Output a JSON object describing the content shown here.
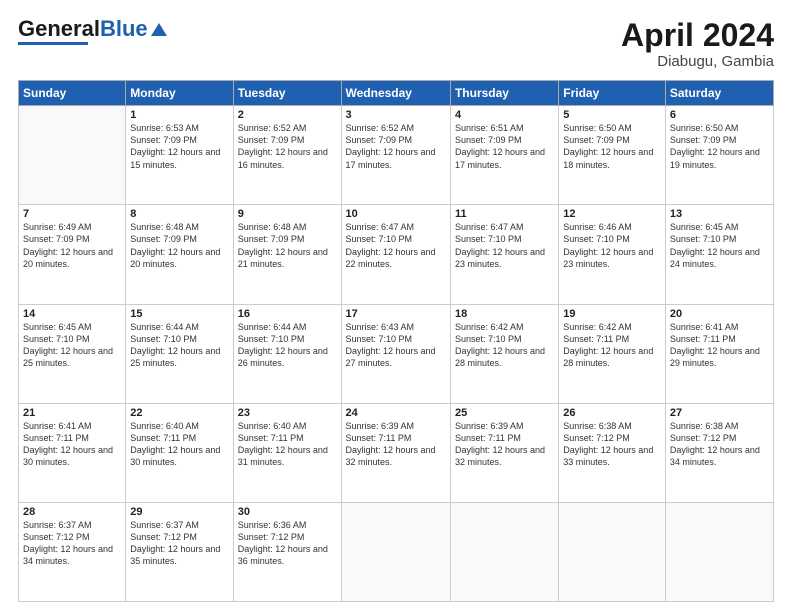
{
  "header": {
    "logo_general": "General",
    "logo_blue": "Blue",
    "month_year": "April 2024",
    "location": "Diabugu, Gambia"
  },
  "weekdays": [
    "Sunday",
    "Monday",
    "Tuesday",
    "Wednesday",
    "Thursday",
    "Friday",
    "Saturday"
  ],
  "weeks": [
    [
      {
        "day": null
      },
      {
        "day": 1,
        "sunrise": "6:53 AM",
        "sunset": "7:09 PM",
        "daylight": "12 hours and 15 minutes."
      },
      {
        "day": 2,
        "sunrise": "6:52 AM",
        "sunset": "7:09 PM",
        "daylight": "12 hours and 16 minutes."
      },
      {
        "day": 3,
        "sunrise": "6:52 AM",
        "sunset": "7:09 PM",
        "daylight": "12 hours and 17 minutes."
      },
      {
        "day": 4,
        "sunrise": "6:51 AM",
        "sunset": "7:09 PM",
        "daylight": "12 hours and 17 minutes."
      },
      {
        "day": 5,
        "sunrise": "6:50 AM",
        "sunset": "7:09 PM",
        "daylight": "12 hours and 18 minutes."
      },
      {
        "day": 6,
        "sunrise": "6:50 AM",
        "sunset": "7:09 PM",
        "daylight": "12 hours and 19 minutes."
      }
    ],
    [
      {
        "day": 7,
        "sunrise": "6:49 AM",
        "sunset": "7:09 PM",
        "daylight": "12 hours and 20 minutes."
      },
      {
        "day": 8,
        "sunrise": "6:48 AM",
        "sunset": "7:09 PM",
        "daylight": "12 hours and 20 minutes."
      },
      {
        "day": 9,
        "sunrise": "6:48 AM",
        "sunset": "7:09 PM",
        "daylight": "12 hours and 21 minutes."
      },
      {
        "day": 10,
        "sunrise": "6:47 AM",
        "sunset": "7:10 PM",
        "daylight": "12 hours and 22 minutes."
      },
      {
        "day": 11,
        "sunrise": "6:47 AM",
        "sunset": "7:10 PM",
        "daylight": "12 hours and 23 minutes."
      },
      {
        "day": 12,
        "sunrise": "6:46 AM",
        "sunset": "7:10 PM",
        "daylight": "12 hours and 23 minutes."
      },
      {
        "day": 13,
        "sunrise": "6:45 AM",
        "sunset": "7:10 PM",
        "daylight": "12 hours and 24 minutes."
      }
    ],
    [
      {
        "day": 14,
        "sunrise": "6:45 AM",
        "sunset": "7:10 PM",
        "daylight": "12 hours and 25 minutes."
      },
      {
        "day": 15,
        "sunrise": "6:44 AM",
        "sunset": "7:10 PM",
        "daylight": "12 hours and 25 minutes."
      },
      {
        "day": 16,
        "sunrise": "6:44 AM",
        "sunset": "7:10 PM",
        "daylight": "12 hours and 26 minutes."
      },
      {
        "day": 17,
        "sunrise": "6:43 AM",
        "sunset": "7:10 PM",
        "daylight": "12 hours and 27 minutes."
      },
      {
        "day": 18,
        "sunrise": "6:42 AM",
        "sunset": "7:10 PM",
        "daylight": "12 hours and 28 minutes."
      },
      {
        "day": 19,
        "sunrise": "6:42 AM",
        "sunset": "7:11 PM",
        "daylight": "12 hours and 28 minutes."
      },
      {
        "day": 20,
        "sunrise": "6:41 AM",
        "sunset": "7:11 PM",
        "daylight": "12 hours and 29 minutes."
      }
    ],
    [
      {
        "day": 21,
        "sunrise": "6:41 AM",
        "sunset": "7:11 PM",
        "daylight": "12 hours and 30 minutes."
      },
      {
        "day": 22,
        "sunrise": "6:40 AM",
        "sunset": "7:11 PM",
        "daylight": "12 hours and 30 minutes."
      },
      {
        "day": 23,
        "sunrise": "6:40 AM",
        "sunset": "7:11 PM",
        "daylight": "12 hours and 31 minutes."
      },
      {
        "day": 24,
        "sunrise": "6:39 AM",
        "sunset": "7:11 PM",
        "daylight": "12 hours and 32 minutes."
      },
      {
        "day": 25,
        "sunrise": "6:39 AM",
        "sunset": "7:11 PM",
        "daylight": "12 hours and 32 minutes."
      },
      {
        "day": 26,
        "sunrise": "6:38 AM",
        "sunset": "7:12 PM",
        "daylight": "12 hours and 33 minutes."
      },
      {
        "day": 27,
        "sunrise": "6:38 AM",
        "sunset": "7:12 PM",
        "daylight": "12 hours and 34 minutes."
      }
    ],
    [
      {
        "day": 28,
        "sunrise": "6:37 AM",
        "sunset": "7:12 PM",
        "daylight": "12 hours and 34 minutes."
      },
      {
        "day": 29,
        "sunrise": "6:37 AM",
        "sunset": "7:12 PM",
        "daylight": "12 hours and 35 minutes."
      },
      {
        "day": 30,
        "sunrise": "6:36 AM",
        "sunset": "7:12 PM",
        "daylight": "12 hours and 36 minutes."
      },
      {
        "day": null
      },
      {
        "day": null
      },
      {
        "day": null
      },
      {
        "day": null
      }
    ]
  ]
}
